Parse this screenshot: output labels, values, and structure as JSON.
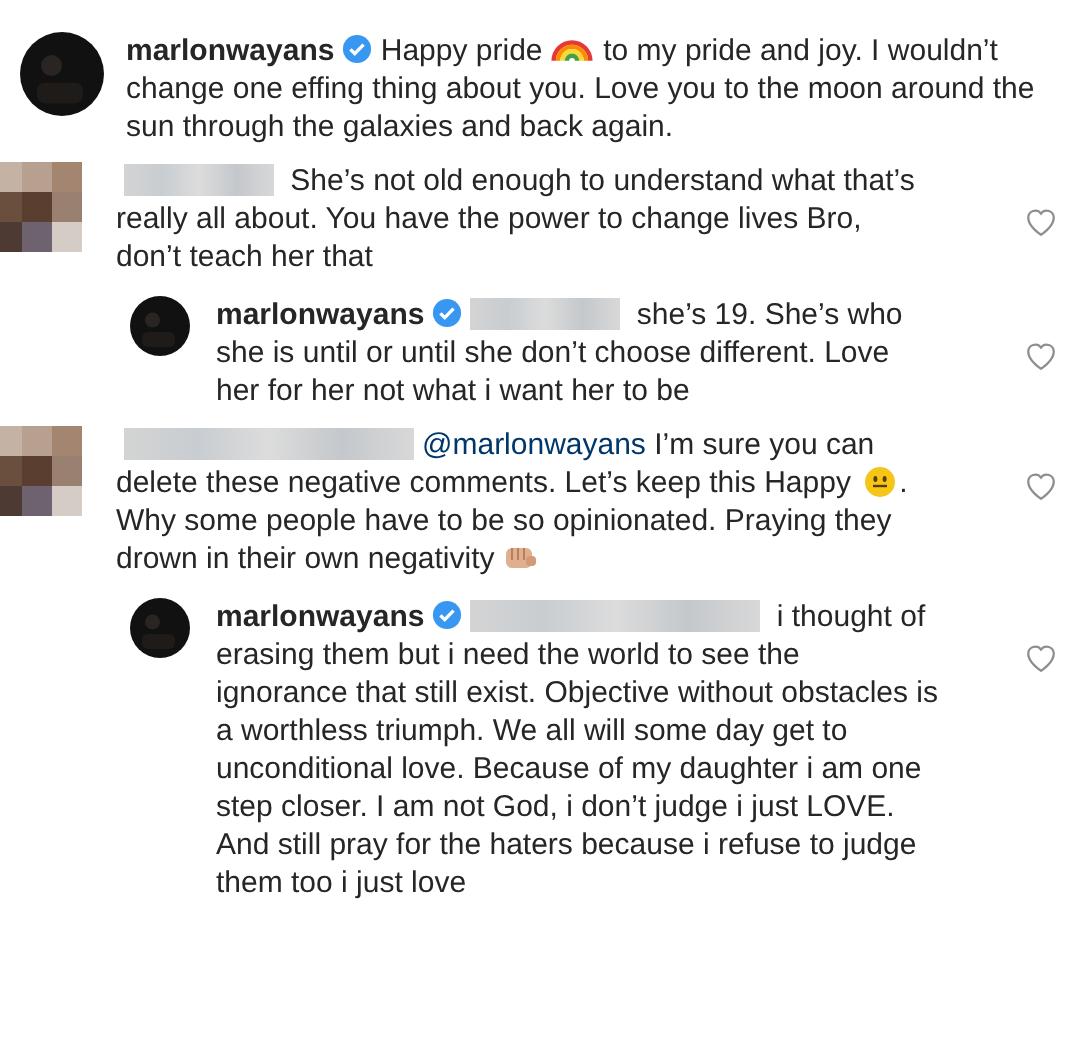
{
  "comments": [
    {
      "kind": "caption",
      "avatar": {
        "kind": "round"
      },
      "reply": false,
      "parts": [
        {
          "kind": "user",
          "text": "marlonwayans"
        },
        {
          "kind": "verified"
        },
        {
          "kind": "text",
          "text": " Happy pride "
        },
        {
          "kind": "rainbow"
        },
        {
          "kind": "text",
          "text": " to my pride and joy. I wouldn’t change one effing thing about you. Love you to the moon around the sun through the galaxies and back again."
        }
      ]
    },
    {
      "kind": "comment",
      "avatar": {
        "kind": "pixelated"
      },
      "reply": false,
      "liked": false,
      "parts": [
        {
          "kind": "blurred",
          "wide": false
        },
        {
          "kind": "text",
          "text": " She’s not old enough to understand what that’s really all about. You have the power to change lives Bro, don’t teach her that"
        }
      ]
    },
    {
      "kind": "comment",
      "avatar": {
        "kind": "round"
      },
      "reply": true,
      "liked": false,
      "parts": [
        {
          "kind": "user",
          "text": "marlonwayans"
        },
        {
          "kind": "verified"
        },
        {
          "kind": "blurred",
          "wide": false
        },
        {
          "kind": "text",
          "text": " she’s 19. She’s who she is until or until she don’t choose different. Love her for her not what i want her to be"
        }
      ]
    },
    {
      "kind": "comment",
      "avatar": {
        "kind": "pixelated"
      },
      "reply": false,
      "liked": false,
      "parts": [
        {
          "kind": "blurred",
          "wide": true
        },
        {
          "kind": "mention",
          "text": "@marlonwayans"
        },
        {
          "kind": "text",
          "text": " I’m sure you can delete these negative comments. Let’s keep this Happy "
        },
        {
          "kind": "smiley"
        },
        {
          "kind": "text",
          "text": ". Why some people have to be so opinionated. Praying they drown in their own negativity "
        },
        {
          "kind": "fist"
        }
      ]
    },
    {
      "kind": "comment",
      "avatar": {
        "kind": "round"
      },
      "reply": true,
      "liked": false,
      "parts": [
        {
          "kind": "user",
          "text": "marlonwayans"
        },
        {
          "kind": "verified"
        },
        {
          "kind": "blurred",
          "wide": true
        },
        {
          "kind": "text",
          "text": " i thought of erasing them but i need the world to see the ignorance that still exist. Objective without obstacles is a worthless triumph. We all will some day get to unconditional love. Because of my daughter i am one step closer. I am not God, i don’t judge i just LOVE. And still pray for the haters because i refuse to judge them too i just love"
        }
      ]
    }
  ]
}
